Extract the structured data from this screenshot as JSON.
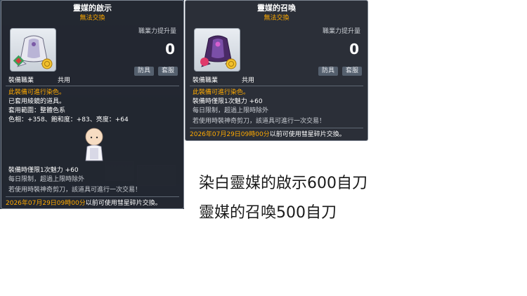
{
  "tooltip_left": {
    "title": "靈媒的啟示",
    "subtitle": "無法交換",
    "boost_label": "職業力提升量",
    "boost_value": "0",
    "tag_a": "防具",
    "tag_b": "套服",
    "job_label": "裝備職業",
    "job_value": "共用",
    "dye_notice": "此裝備可進行染色。",
    "dye_applied": "已套用綾鏡的道具。",
    "dye_range": "套用範圍：整體色系",
    "dye_values": "色相：+358、飽和度：+83、亮度：+64",
    "charm": "裝備時僅限1次魅力 +60",
    "daily": "每日限制，超過上限時除外",
    "scissors": "若使用時裝神奇剪刀，該道具可進行一次交易！",
    "date": "2026年07月29日09時00分",
    "date_suffix": "以前可使用彗星碎片交換。"
  },
  "tooltip_right": {
    "title": "靈媒的召喚",
    "subtitle": "無法交換",
    "boost_label": "職業力提升量",
    "boost_value": "0",
    "tag_a": "防具",
    "tag_b": "套服",
    "job_label": "裝備職業",
    "job_value": "共用",
    "dye_notice": "此裝備可進行染色。",
    "charm": "裝備時僅限1次魅力 +60",
    "daily": "每日限制，超過上限時除外",
    "scissors": "若使用時裝神奇剪刀，該道具可進行一次交易！",
    "date": "2026年07月29日09時00分",
    "date_suffix": "以前可使用彗星碎片交換。"
  },
  "notes": {
    "line1": "染白靈媒的啟示600自刀",
    "line2": "靈媒的召喚500自刀"
  },
  "icons": {
    "left_item": "white-robe-item-icon",
    "right_item": "purple-robe-item-icon",
    "avatar": "character-avatar-icon"
  },
  "colors": {
    "tooltip_bg": "#22272f",
    "accent_orange": "#ffaa00"
  }
}
